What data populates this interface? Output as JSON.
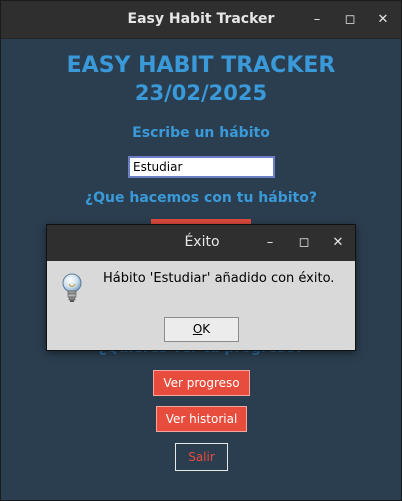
{
  "window": {
    "title": "Easy Habit Tracker",
    "controls": {
      "min": "–",
      "max": "◻",
      "close": "✕"
    }
  },
  "app": {
    "title": "EASY HABIT TRACKER",
    "date": "23/02/2025",
    "prompt_habit": "Escribe un hábito",
    "habit_value": "Estudiar",
    "prompt_action": "¿Que hacemos con tu hábito?",
    "prompt_progress": "¿Quieres ver tu progreso?",
    "buttons": {
      "progreso": "Ver progreso",
      "historial": "Ver historial",
      "salir": "Salir"
    },
    "colors": {
      "accent": "#3a9ad9",
      "button_red": "#e74c3c",
      "background": "#2b3e50"
    }
  },
  "dialog": {
    "title": "Éxito",
    "message": "Hábito 'Estudiar' añadido con éxito.",
    "ok_underlined": "O",
    "ok_rest": "K",
    "icon": "lightbulb-icon",
    "controls": {
      "min": "–",
      "max": "◻",
      "close": "✕"
    }
  }
}
